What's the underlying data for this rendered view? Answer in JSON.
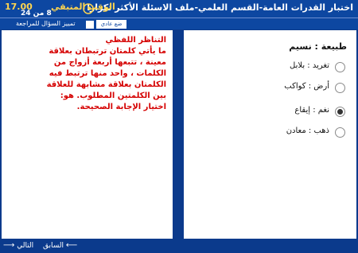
{
  "header": {
    "title": "اختبار القدرات العامة-القسم العلمي-ملف الاسئلة الأكثر تكرارا",
    "timer_label": "الوقت المتبقي",
    "timer_value": "17.00",
    "progress": "8 من 24"
  },
  "toolbar": {
    "review_label": "تمييز السؤال للمراجعة",
    "review_button": "ضع عادي"
  },
  "passage": {
    "text": "التناظر اللفظي\nما يأتي كلمتان ترتبطان بعلاقة معينة ، تتبعها أربعة أزواج من الكلمات ، واحد منها ترتبط فيه الكلمتان بعلاقة مشابهة للعلاقة بين الكلمتين المطلوب. هو: اختيار الإجابة الصحيحة."
  },
  "question": {
    "stem": "طبيعة : نسيم",
    "options": [
      {
        "label": "تغريد : بلابل",
        "selected": false
      },
      {
        "label": "أرض : كواكب",
        "selected": false
      },
      {
        "label": "نغم : إيقاع",
        "selected": true
      },
      {
        "label": "ذهب : معادن",
        "selected": false
      }
    ]
  },
  "footer": {
    "prev_label": "السابق",
    "next_label": "التالي"
  },
  "colors": {
    "header_bg": "#0d47a1",
    "timer": "#ffd54f",
    "passage_text": "#d50000"
  }
}
